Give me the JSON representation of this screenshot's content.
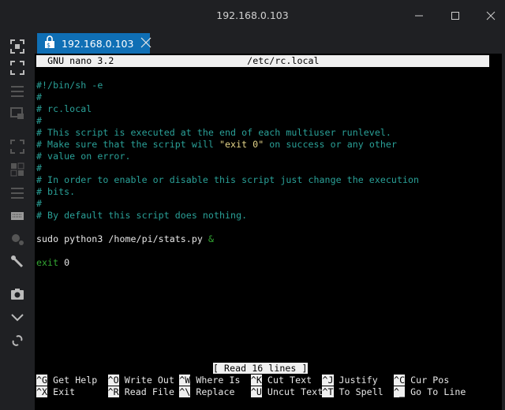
{
  "window": {
    "title": "192.168.0.103"
  },
  "tab": {
    "label": "192.168.0.103"
  },
  "nano": {
    "header_left": "GNU nano 3.2",
    "header_file": "/etc/rc.local",
    "status": "[ Read 16 lines ]"
  },
  "file_lines": [
    "#!/bin/sh -e",
    "#",
    "# rc.local",
    "#",
    "# This script is executed at the end of each multiuser runlevel.",
    "# Make sure that the script will ",
    "\"exit 0\"",
    " on success or any other",
    "# value on error.",
    "#",
    "# In order to enable or disable this script just change the execution",
    "# bits.",
    "#",
    "# By default this script does nothing.",
    "sudo python3 /home/pi/stats.py ",
    "&",
    "exit",
    " 0"
  ],
  "shortcuts": [
    {
      "key": "^G",
      "label": "Get Help"
    },
    {
      "key": "^O",
      "label": "Write Out"
    },
    {
      "key": "^W",
      "label": "Where Is"
    },
    {
      "key": "^K",
      "label": "Cut Text"
    },
    {
      "key": "^J",
      "label": "Justify"
    },
    {
      "key": "^C",
      "label": "Cur Pos"
    },
    {
      "key": "^X",
      "label": "Exit"
    },
    {
      "key": "^R",
      "label": "Read File"
    },
    {
      "key": "^\\",
      "label": "Replace"
    },
    {
      "key": "^U",
      "label": "Uncut Text"
    },
    {
      "key": "^T",
      "label": "To Spell"
    },
    {
      "key": "^_",
      "label": "Go To Line"
    }
  ],
  "colors": {
    "tab": "#0f6fb5",
    "comment": "#2aa198",
    "string": "#e6d68a",
    "keyword": "#33a833"
  }
}
